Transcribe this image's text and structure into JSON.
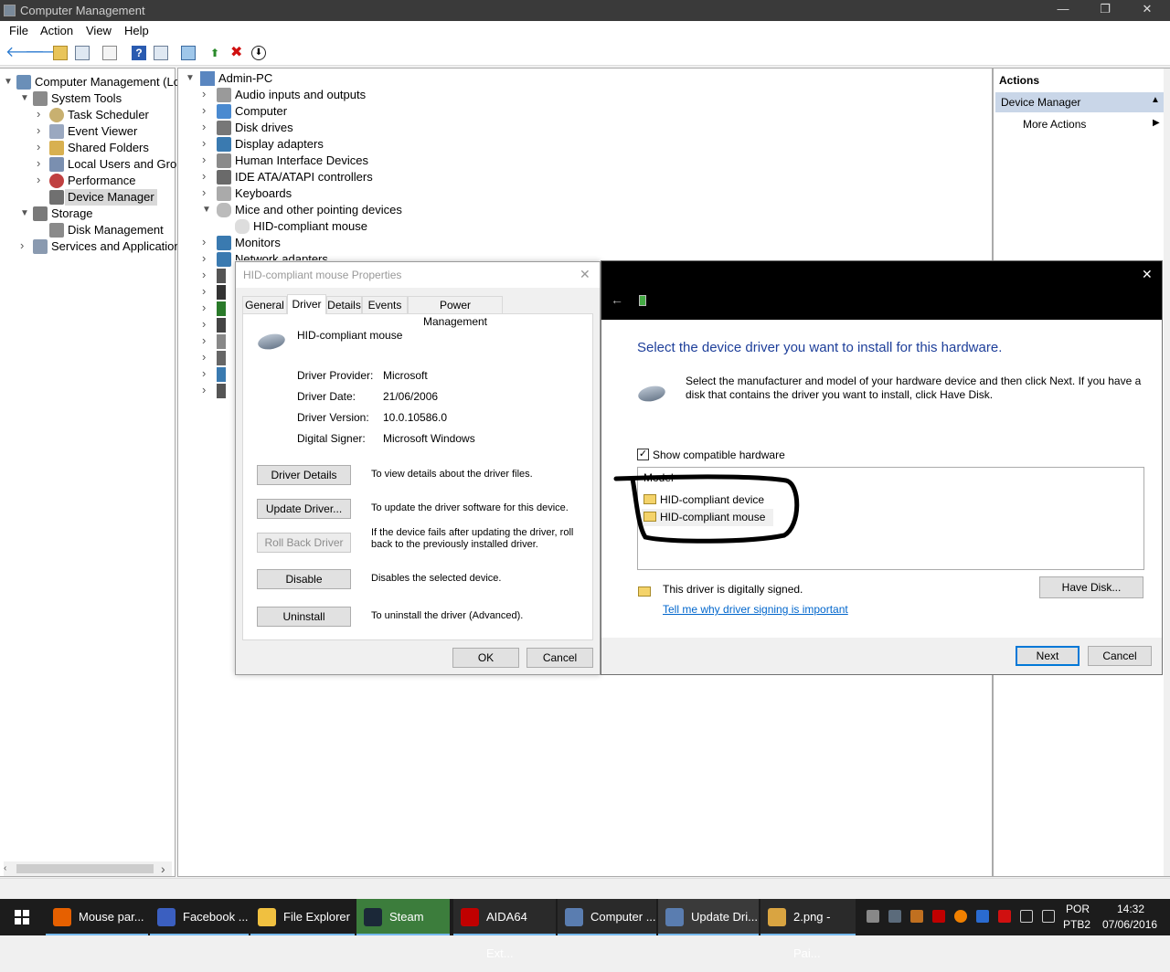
{
  "window": {
    "title": "Computer Management",
    "minimize": "—",
    "maximize": "❐",
    "close": "✕"
  },
  "menu": [
    "File",
    "Action",
    "View",
    "Help"
  ],
  "left_tree": [
    {
      "label": "Computer Management (Local",
      "level": 0
    },
    {
      "label": "System Tools",
      "level": 1
    },
    {
      "label": "Task Scheduler",
      "level": 2
    },
    {
      "label": "Event Viewer",
      "level": 2
    },
    {
      "label": "Shared Folders",
      "level": 2
    },
    {
      "label": "Local Users and Groups",
      "level": 2
    },
    {
      "label": "Performance",
      "level": 2
    },
    {
      "label": "Device Manager",
      "level": 2,
      "selected": true
    },
    {
      "label": "Storage",
      "level": 1
    },
    {
      "label": "Disk Management",
      "level": 2
    },
    {
      "label": "Services and Applications",
      "level": 1
    }
  ],
  "device_tree": {
    "root": "Admin-PC",
    "items": [
      "Audio inputs and outputs",
      "Computer",
      "Disk drives",
      "Display adapters",
      "Human Interface Devices",
      "IDE ATA/ATAPI controllers",
      "Keyboards",
      "Mice and other pointing devices",
      "HID-compliant mouse",
      "Monitors",
      "Network adapters"
    ]
  },
  "actions": {
    "header": "Actions",
    "section": "Device Manager",
    "more": "More Actions"
  },
  "props": {
    "title": "HID-compliant mouse Properties",
    "tabs": [
      "General",
      "Driver",
      "Details",
      "Events",
      "Power Management"
    ],
    "device": "HID-compliant mouse",
    "fields": [
      {
        "k": "Driver Provider:",
        "v": "Microsoft"
      },
      {
        "k": "Driver Date:",
        "v": "21/06/2006"
      },
      {
        "k": "Driver Version:",
        "v": "10.0.10586.0"
      },
      {
        "k": "Digital Signer:",
        "v": "Microsoft Windows"
      }
    ],
    "buttons": [
      {
        "label": "Driver Details",
        "desc": "To view details about the driver files."
      },
      {
        "label": "Update Driver...",
        "desc": "To update the driver software for this device."
      },
      {
        "label": "Roll Back Driver",
        "desc": "If the device fails after updating the driver, roll back to the previously installed driver."
      },
      {
        "label": "Disable",
        "desc": "Disables the selected device."
      },
      {
        "label": "Uninstall",
        "desc": "To uninstall the driver (Advanced)."
      }
    ],
    "ok": "OK",
    "cancel": "Cancel"
  },
  "wizard": {
    "heading": "Select the device driver you want to install for this hardware.",
    "desc": "Select the manufacturer and model of your hardware device and then click Next. If you have a disk that contains the driver you want to install, click Have Disk.",
    "show_compat": "Show compatible hardware",
    "list_header": "Model",
    "models": [
      "HID-compliant device",
      "HID-compliant mouse"
    ],
    "signed": "This driver is digitally signed.",
    "link": "Tell me why driver signing is important",
    "have_disk": "Have Disk...",
    "next": "Next",
    "cancel": "Cancel"
  },
  "taskbar": [
    {
      "label": "Mouse par...",
      "color": "#e66000"
    },
    {
      "label": "Facebook ...",
      "color": "#3b5fc0"
    },
    {
      "label": "File Explorer",
      "color": "#f0c040"
    },
    {
      "label": "Steam",
      "color": "#1b2838"
    },
    {
      "label": "AIDA64 Ext...",
      "color": "#c00000"
    },
    {
      "label": "Computer ...",
      "color": "#5a7db0"
    },
    {
      "label": "Update Dri...",
      "color": "#5a7db0"
    },
    {
      "label": "2.png - Pai...",
      "color": "#d9a441"
    }
  ],
  "clock": {
    "lang": "POR",
    "layout": "PTB2",
    "time": "14:32",
    "date": "07/06/2016"
  }
}
